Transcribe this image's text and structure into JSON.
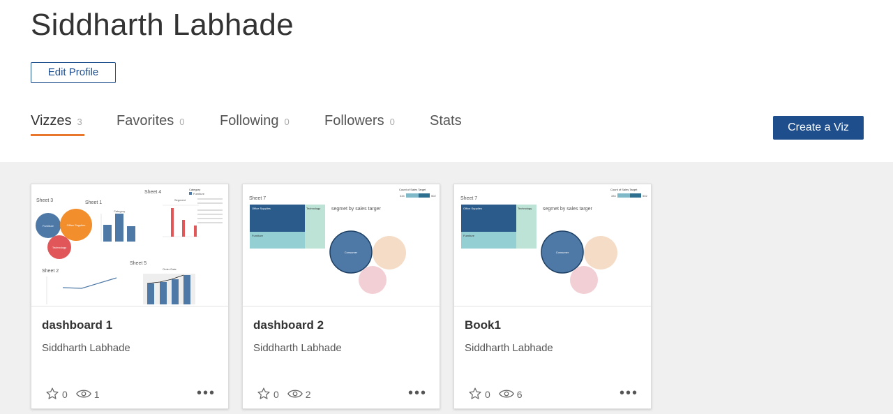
{
  "profile": {
    "name": "Siddharth Labhade",
    "edit_label": "Edit Profile"
  },
  "tabs": [
    {
      "label": "Vizzes",
      "count": "3"
    },
    {
      "label": "Favorites",
      "count": "0"
    },
    {
      "label": "Following",
      "count": "0"
    },
    {
      "label": "Followers",
      "count": "0"
    },
    {
      "label": "Stats",
      "count": ""
    }
  ],
  "create_label": "Create a Viz",
  "colors": {
    "accent": "#e8762c",
    "brand": "#1f4e8c",
    "gallery_bg": "#f0f0f0"
  },
  "cards": [
    {
      "title": "dashboard 1",
      "author": "Siddharth Labhade",
      "favorites": "0",
      "views": "1",
      "more": "•••"
    },
    {
      "title": "dashboard 2",
      "author": "Siddharth Labhade",
      "favorites": "0",
      "views": "2",
      "more": "•••"
    },
    {
      "title": "Book1",
      "author": "Siddharth Labhade",
      "favorites": "0",
      "views": "6",
      "more": "•••"
    }
  ],
  "thumbnails": {
    "dash1": {
      "sheet3": "Sheet 3",
      "sheet1": "Sheet 1",
      "sheet4": "Sheet 4",
      "sheet2": "Sheet 2",
      "sheet5": "Sheet 5",
      "bubble_furniture": "Furniture",
      "bubble_office": "Office Supplies",
      "bubble_tech": "Technology",
      "category": "Category",
      "segment": "Segment",
      "order_date": "Order Date",
      "legend_title": "Category",
      "legend_furniture": "Furniture"
    },
    "dash2": {
      "sheet7": "Sheet 7",
      "office": "Office Supplies",
      "technology": "Technology",
      "furniture": "Furniture",
      "segment_title": "segmet  by sales targer",
      "consumer": "Consumer",
      "legend": "Count of Sales Target",
      "legend_min": "334",
      "legend_max": "502"
    }
  }
}
